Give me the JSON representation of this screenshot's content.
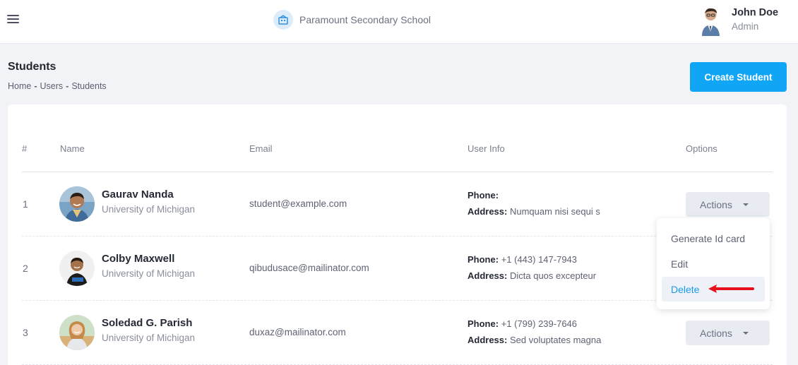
{
  "header": {
    "school_name": "Paramount Secondary School",
    "user_name": "John Doe",
    "user_role": "Admin",
    "logo_icon": "school-icon",
    "menu_icon": "hamburger-menu-icon"
  },
  "page": {
    "title": "Students",
    "breadcrumb": [
      "Home",
      "Users",
      "Students"
    ],
    "breadcrumb_separator": "-",
    "create_button": "Create Student"
  },
  "table": {
    "columns": [
      "#",
      "Name",
      "Email",
      "User Info",
      "Options"
    ],
    "phone_label": "Phone:",
    "address_label": "Address:",
    "actions_label": "Actions",
    "rows": [
      {
        "index": "1",
        "name": "Gaurav Nanda",
        "university": "University of Michigan",
        "email": "student@example.com",
        "phone": "",
        "address": "Numquam nisi sequi s"
      },
      {
        "index": "2",
        "name": "Colby Maxwell",
        "university": "University of Michigan",
        "email": "qibudusace@mailinator.com",
        "phone": "+1 (443) 147-7943",
        "address": "Dicta quos excepteur"
      },
      {
        "index": "3",
        "name": "Soledad G. Parish",
        "university": "University of Michigan",
        "email": "duxaz@mailinator.com",
        "phone": "+1 (799) 239-7646",
        "address": "Sed voluptates magna"
      }
    ]
  },
  "dropdown": {
    "items": [
      "Generate Id card",
      "Edit",
      "Delete"
    ],
    "active_item": "Delete"
  },
  "colors": {
    "accent": "#10a5f5",
    "active_text": "#1a9be6",
    "arrow": "#e8101d"
  }
}
